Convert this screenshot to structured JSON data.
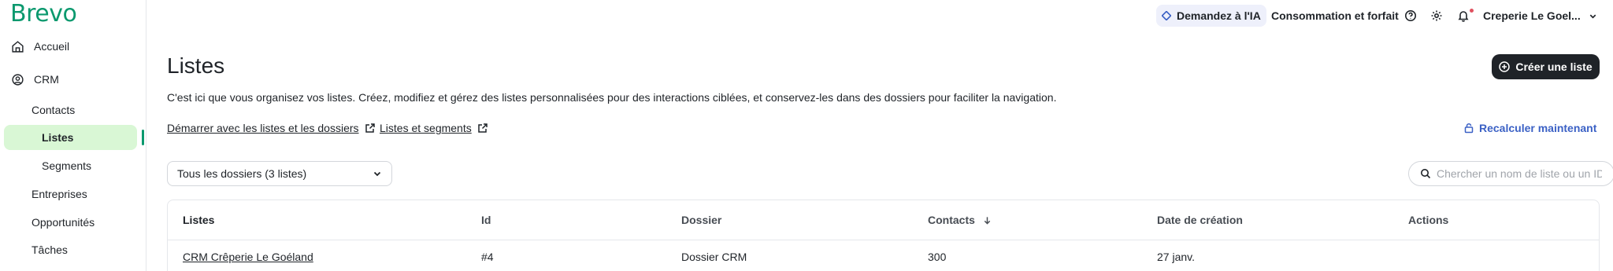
{
  "app": {
    "logo": "Brevo"
  },
  "sidebar": {
    "items": [
      {
        "label": "Accueil",
        "icon": "home-icon"
      },
      {
        "label": "CRM",
        "icon": "user-circle-icon"
      },
      {
        "label": "Contacts"
      },
      {
        "label": "Listes",
        "active": true
      },
      {
        "label": "Segments"
      },
      {
        "label": "Entreprises"
      },
      {
        "label": "Opportunités"
      },
      {
        "label": "Tâches"
      }
    ]
  },
  "topbar": {
    "ai_label": "Demandez à l'IA",
    "plan_label": "Consommation et forfait",
    "account_label": "Creperie Le Goel...",
    "icons": [
      "help-icon",
      "settings-icon",
      "bell-icon",
      "chevron-down-icon"
    ]
  },
  "page": {
    "title": "Listes",
    "create_button": "Créer une liste",
    "description": "C'est ici que vous organisez vos listes. Créez, modifiez et gérez des listes personnalisées pour des interactions ciblées, et conservez-les dans des dossiers pour faciliter la navigation.",
    "links": [
      "Démarrer avec les listes et les dossiers",
      "Listes et segments"
    ],
    "recalculate": "Recalculer maintenant",
    "folder_select": "Tous les dossiers (3 listes)",
    "search_placeholder": "Chercher un nom de liste ou un ID"
  },
  "table": {
    "headers": [
      "Listes",
      "Id",
      "Dossier",
      "Contacts",
      "Date de création",
      "Actions"
    ],
    "rows": [
      [
        "CRM Crêperie Le Goéland",
        "#4",
        "Dossier CRM",
        "300",
        "27 janv."
      ]
    ]
  },
  "colors": {
    "brand": "#0b996e",
    "active_bg": "#d9f7d5",
    "link_blue": "#3b61c5",
    "button_dark": "#1f2328"
  }
}
